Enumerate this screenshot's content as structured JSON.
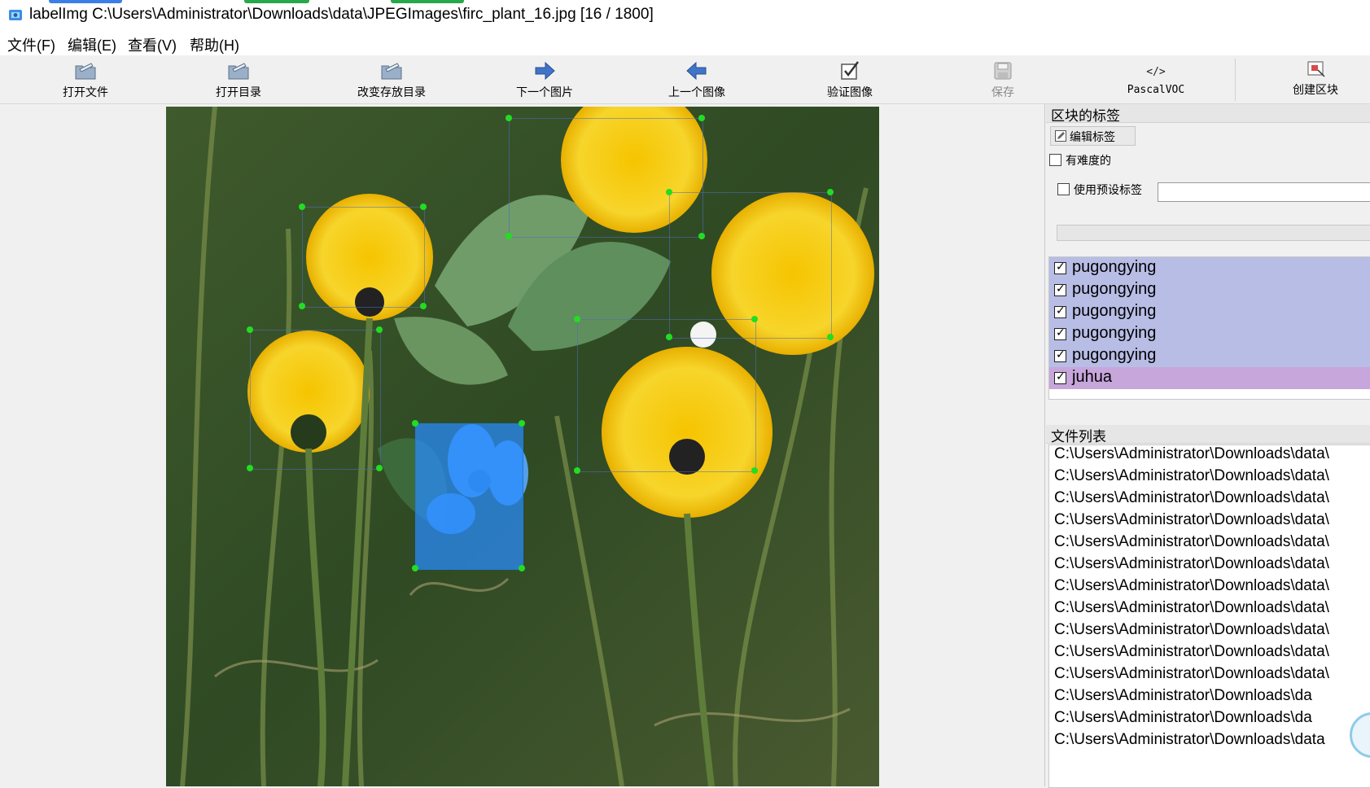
{
  "window": {
    "title": "labelImg C:\\Users\\Administrator\\Downloads\\data\\JPEGImages\\firc_plant_16.jpg [16 / 1800]"
  },
  "menu": [
    "文件(F)",
    "编辑(E)",
    "查看(V)",
    "帮助(H)"
  ],
  "toolbar": {
    "open_file": "打开文件",
    "open_dir": "打开目录",
    "change_save_dir": "改变存放目录",
    "next_image": "下一个图片",
    "prev_image": "上一个图像",
    "verify_image": "验证图像",
    "save": "保存",
    "format": "PascalVOC",
    "create_box": "创建区块"
  },
  "dock": {
    "labels_title": "区块的标签",
    "edit_label": "编辑标签",
    "difficult": "有难度的",
    "use_default_label": "使用预设标签",
    "default_label_value": "",
    "file_list_title": "文件列表"
  },
  "labels": [
    {
      "name": "pugongying",
      "checked": true
    },
    {
      "name": "pugongying",
      "checked": true
    },
    {
      "name": "pugongying",
      "checked": true
    },
    {
      "name": "pugongying",
      "checked": true
    },
    {
      "name": "pugongying",
      "checked": true
    },
    {
      "name": "juhua",
      "checked": true
    }
  ],
  "files": [
    "C:\\Users\\Administrator\\Downloads\\data\\",
    "C:\\Users\\Administrator\\Downloads\\data\\",
    "C:\\Users\\Administrator\\Downloads\\data\\",
    "C:\\Users\\Administrator\\Downloads\\data\\",
    "C:\\Users\\Administrator\\Downloads\\data\\",
    "C:\\Users\\Administrator\\Downloads\\data\\",
    "C:\\Users\\Administrator\\Downloads\\data\\",
    "C:\\Users\\Administrator\\Downloads\\data\\",
    "C:\\Users\\Administrator\\Downloads\\data\\",
    "C:\\Users\\Administrator\\Downloads\\data\\",
    "C:\\Users\\Administrator\\Downloads\\data\\",
    "C:\\Users\\Administrator\\Downloads\\da",
    "C:\\Users\\Administrator\\Downloads\\da",
    "C:\\Users\\Administrator\\Downloads\\data"
  ],
  "colors": {
    "label_row": "#b8bde6",
    "label_row_selected": "#c7a6db",
    "selected_box": "#2a8cff",
    "handle": "#22dd22"
  }
}
